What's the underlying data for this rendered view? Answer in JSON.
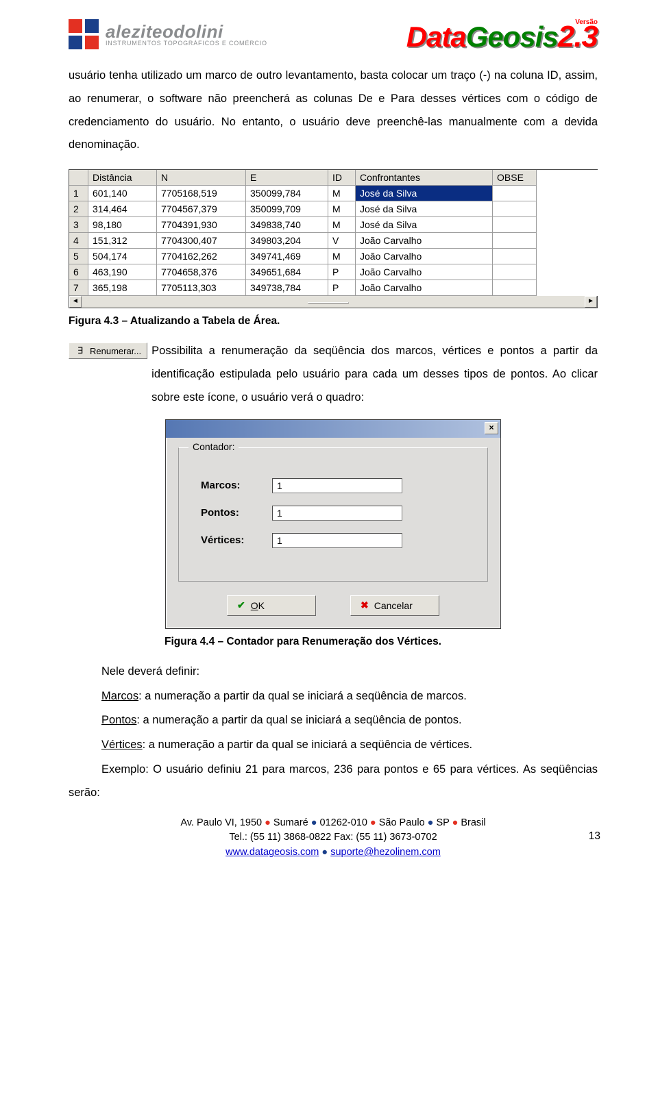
{
  "header": {
    "brand_left_name": "aleziteodolini",
    "brand_left_sub": "INSTRUMENTOS TOPOGRÁFICOS E COMÉRCIO",
    "brand_right_versao": "Versão",
    "brand_right_dg_data": "Data",
    "brand_right_dg_geosis": "Geosis",
    "brand_right_ver": "2.3"
  },
  "body": {
    "p1": "usuário tenha utilizado um marco de outro levantamento, basta colocar um traço (-) na coluna ID, assim, ao renumerar, o software não preencherá as colunas De e Para desses vértices com o código de credenciamento do usuário. No entanto, o usuário deve preenchê-las manualmente com a devida denominação.",
    "cap1": "Figura 4.3 – Atualizando a Tabela de Área.",
    "renum_btn": "Renumerar...",
    "p2a": " Possibilita a renumeração da seqüência dos marcos, vértices e pontos a partir da identificação estipulada pelo usuário para cada um desses tipos de pontos. Ao clicar sobre este ícone, o usuário verá o quadro:",
    "cap2": "Figura 4.4 – Contador para Renumeração dos Vértices.",
    "p3": "Nele deverá definir:",
    "p4a": "Marcos",
    "p4b": ": a numeração a partir da qual se iniciará a seqüência de marcos.",
    "p5a": "Pontos",
    "p5b": ": a numeração a partir da qual se iniciará a seqüência de pontos.",
    "p6a": "Vértices",
    "p6b": ": a numeração a partir da qual se iniciará a seqüência de vértices.",
    "p7": "Exemplo: O usuário definiu 21 para marcos, 236 para pontos e 65 para vértices. As seqüências serão:"
  },
  "table": {
    "headers": [
      "",
      "Distância",
      "N",
      "E",
      "ID",
      "Confrontantes",
      "OBSE"
    ],
    "rows": [
      [
        "1",
        "601,140",
        "7705168,519",
        "350099,784",
        "M",
        "José da Silva",
        ""
      ],
      [
        "2",
        "314,464",
        "7704567,379",
        "350099,709",
        "M",
        "José da Silva",
        ""
      ],
      [
        "3",
        "98,180",
        "7704391,930",
        "349838,740",
        "M",
        "José da Silva",
        ""
      ],
      [
        "4",
        "151,312",
        "7704300,407",
        "349803,204",
        "V",
        "João Carvalho",
        ""
      ],
      [
        "5",
        "504,174",
        "7704162,262",
        "349741,469",
        "M",
        "João Carvalho",
        ""
      ],
      [
        "6",
        "463,190",
        "7704658,376",
        "349651,684",
        "P",
        "João Carvalho",
        ""
      ],
      [
        "7",
        "365,198",
        "7705113,303",
        "349738,784",
        "P",
        "João Carvalho",
        ""
      ]
    ],
    "selected_row_index": 0,
    "selected_col_index": 5
  },
  "dialog": {
    "legend": "Contador:",
    "rows": [
      {
        "label": "Marcos:",
        "value": "1"
      },
      {
        "label": "Pontos:",
        "value": "1"
      },
      {
        "label": "Vértices:",
        "value": "1"
      }
    ],
    "ok": "OK",
    "cancel": "Cancelar"
  },
  "footer": {
    "l1_a": "Av. Paulo VI, 1950 ",
    "l1_b": " Sumaré ",
    "l1_c": " 01262-010 ",
    "l1_d": " São Paulo ",
    "l1_e": " SP ",
    "l1_f": " Brasil",
    "l2": "Tel.: (55 11) 3868-0822 Fax: (55 11) 3673-0702",
    "l3a": "www.datageosis.com",
    "l3b": "suporte@hezolinem.com",
    "page": "13"
  }
}
